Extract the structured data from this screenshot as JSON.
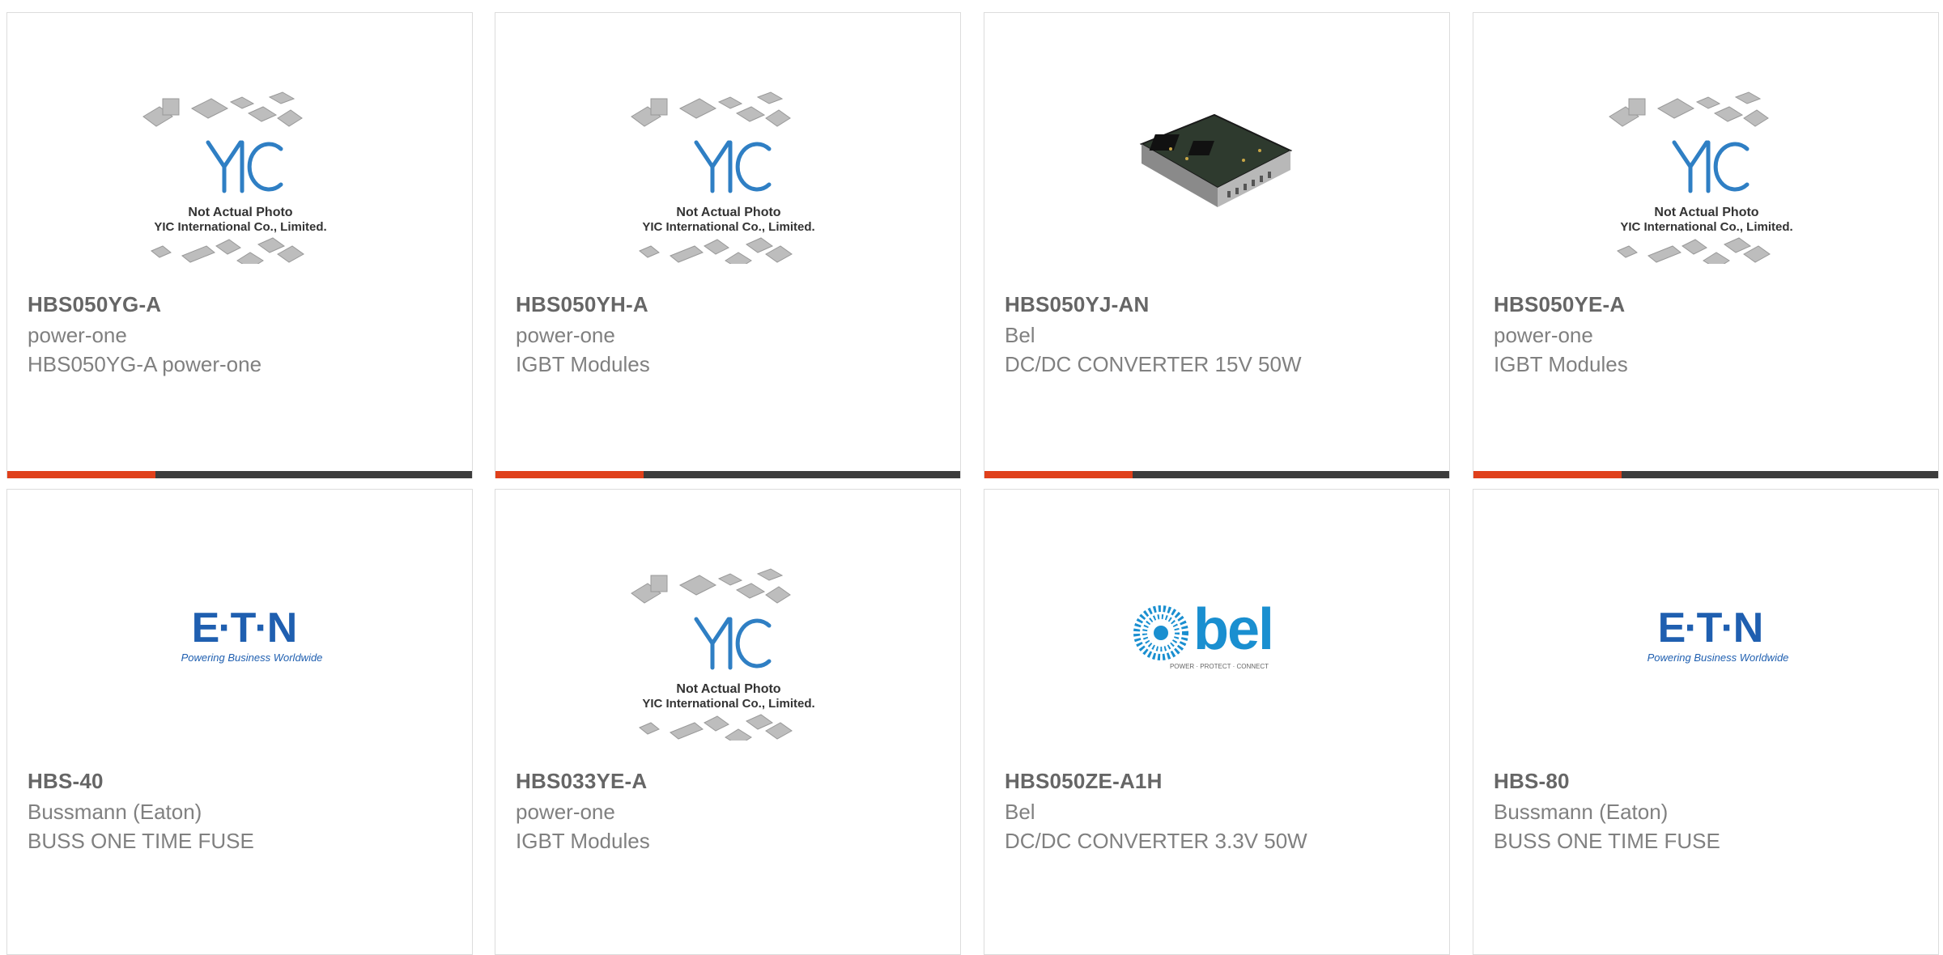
{
  "products": [
    {
      "part_number": "HBS050YG-A",
      "manufacturer": "power-one",
      "description": "HBS050YG-A power-one",
      "image": "yic-placeholder"
    },
    {
      "part_number": "HBS050YH-A",
      "manufacturer": "power-one",
      "description": "IGBT Modules",
      "image": "yic-placeholder"
    },
    {
      "part_number": "HBS050YJ-AN",
      "manufacturer": "Bel",
      "description": "DC/DC CONVERTER 15V 50W",
      "image": "dcdc-module-photo"
    },
    {
      "part_number": "HBS050YE-A",
      "manufacturer": "power-one",
      "description": "IGBT Modules",
      "image": "yic-placeholder"
    },
    {
      "part_number": "HBS-40",
      "manufacturer": "Bussmann (Eaton)",
      "description": "BUSS ONE TIME FUSE",
      "image": "eaton-logo"
    },
    {
      "part_number": "HBS033YE-A",
      "manufacturer": "power-one",
      "description": "IGBT Modules",
      "image": "yic-placeholder"
    },
    {
      "part_number": "HBS050ZE-A1H",
      "manufacturer": "Bel",
      "description": "DC/DC CONVERTER 3.3V 50W",
      "image": "bel-logo"
    },
    {
      "part_number": "HBS-80",
      "manufacturer": "Bussmann (Eaton)",
      "description": "BUSS ONE TIME FUSE",
      "image": "eaton-logo"
    }
  ],
  "placeholder_image": {
    "line1": "Not Actual Photo",
    "line2": "YIC International Co., Limited.",
    "logo_text": "YIC"
  },
  "eaton_logo": {
    "wordmark": "E·T·N",
    "tagline": "Powering Business Worldwide"
  },
  "bel_logo": {
    "wordmark": "bel",
    "tagline": "POWER · PROTECT · CONNECT"
  },
  "colors": {
    "accent": "#e0401b",
    "bar": "#3c3c3c",
    "eaton_blue": "#1f5fb0",
    "bel_blue": "#1a8fd0",
    "yic_blue": "#2f7fc4"
  }
}
